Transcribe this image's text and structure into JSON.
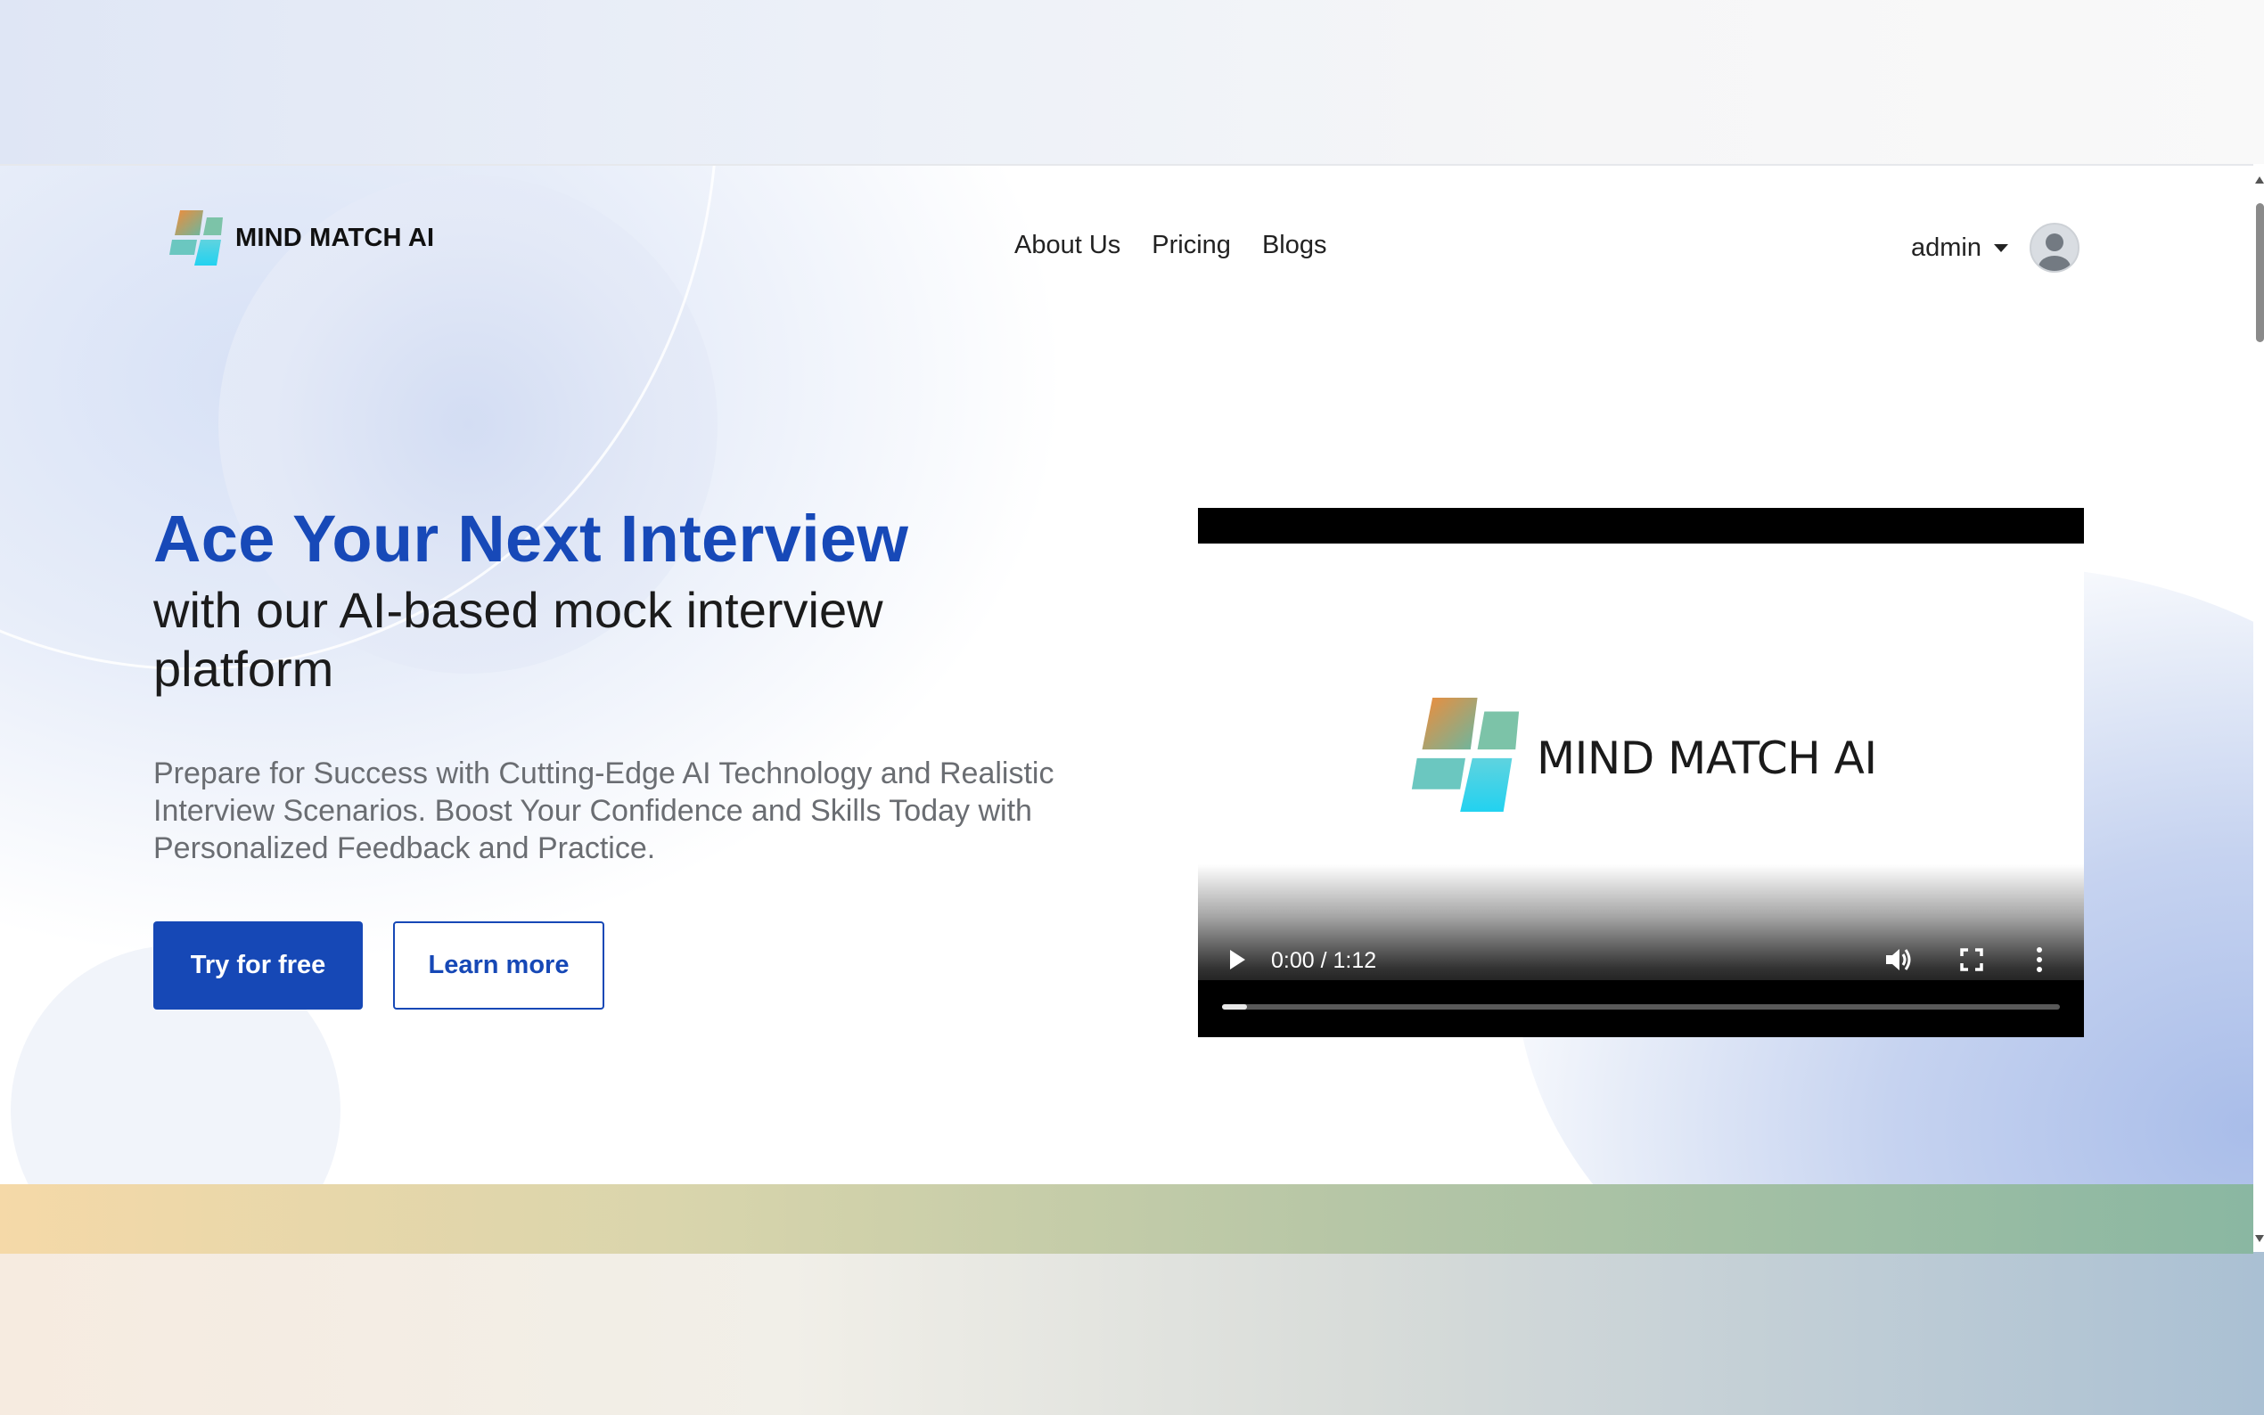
{
  "brand": {
    "name": "MIND MATCH AI"
  },
  "nav": {
    "items": [
      {
        "label": "About Us"
      },
      {
        "label": "Pricing"
      },
      {
        "label": "Blogs"
      }
    ]
  },
  "user": {
    "name": "admin"
  },
  "hero": {
    "title": "Ace Your Next Interview",
    "subtitle": "with our AI-based mock interview platform",
    "description": "Prepare for Success with Cutting-Edge AI Technology and Realistic Interview Scenarios. Boost Your Confidence and Skills Today with Personalized Feedback and Practice.",
    "primary_button": "Try for free",
    "secondary_button": "Learn more"
  },
  "video": {
    "brand_text": "MIND MATCH AI",
    "time": "0:00 / 1:12",
    "progress_fraction": 0.03
  },
  "colors": {
    "accent": "#1648b6",
    "title": "#1749b8"
  }
}
